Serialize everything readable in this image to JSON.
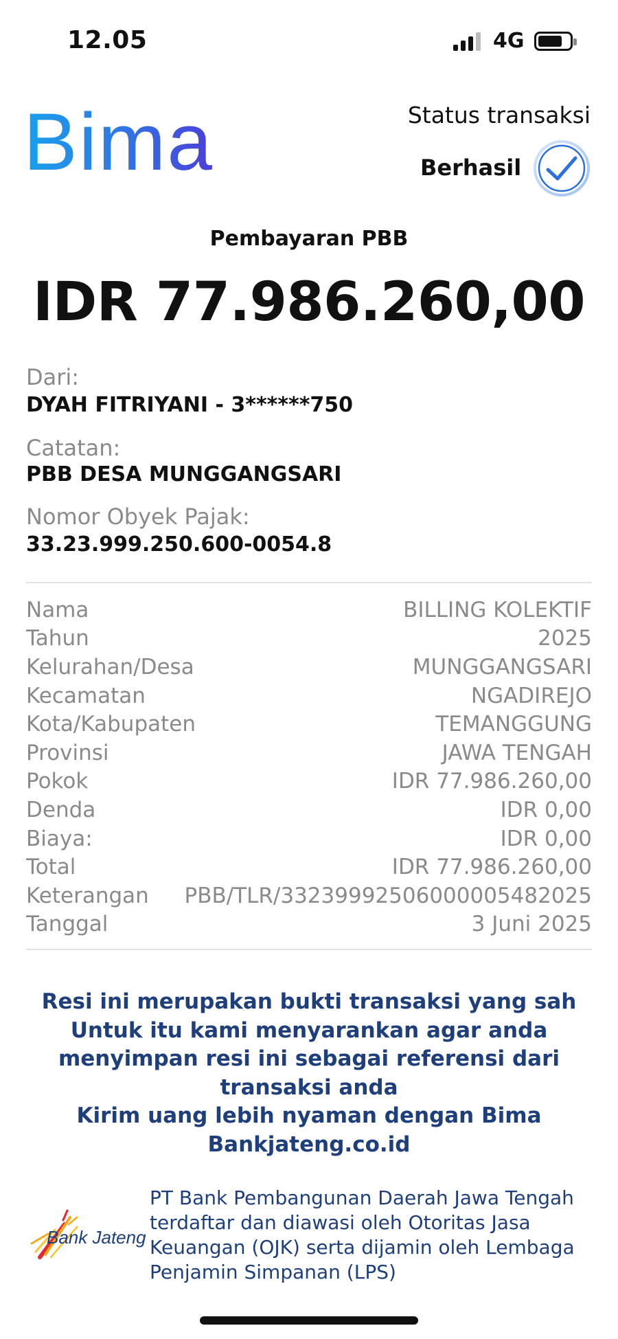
{
  "status_bar": {
    "time": "12.05",
    "network": "4G"
  },
  "header": {
    "logo_text": "Bima",
    "status_label": "Status transaksi",
    "status_value": "Berhasil",
    "status_icon": "checkmark-circle-icon"
  },
  "transaction": {
    "title": "Pembayaran PBB",
    "amount": "IDR 77.986.260,00"
  },
  "fields": {
    "from_label": "Dari:",
    "from_value": "DYAH FITRIYANI - 3******750",
    "note_label": "Catatan:",
    "note_value": "PBB DESA MUNGGANGSARI",
    "tax_object_label": "Nomor Obyek Pajak:",
    "tax_object_value": "33.23.999.250.600-0054.8"
  },
  "details": [
    {
      "label": "Nama",
      "value": "BILLING KOLEKTIF"
    },
    {
      "label": "Tahun",
      "value": "2025"
    },
    {
      "label": "Kelurahan/Desa",
      "value": "MUNGGANGSARI"
    },
    {
      "label": "Kecamatan",
      "value": "NGADIREJO"
    },
    {
      "label": "Kota/Kabupaten",
      "value": "TEMANGGUNG"
    },
    {
      "label": "Provinsi",
      "value": "JAWA TENGAH"
    },
    {
      "label": "Pokok",
      "value": "IDR 77.986.260,00"
    },
    {
      "label": "Denda",
      "value": "IDR 0,00"
    },
    {
      "label": "Biaya:",
      "value": "IDR 0,00"
    },
    {
      "label": "Total",
      "value": "IDR 77.986.260,00"
    },
    {
      "label": "Keterangan",
      "value": "PBB/TLR/33239992506000005482025"
    },
    {
      "label": "Tanggal",
      "value": "3 Juni 2025"
    }
  ],
  "footer_note": {
    "line1": "Resi ini merupakan bukti transaksi yang sah",
    "line2": "Untuk itu kami menyarankan agar anda",
    "line3": "menyimpan resi ini sebagai referensi dari",
    "line4": "transaksi anda",
    "line5": "Kirim uang lebih nyaman dengan Bima",
    "line6": "Bankjateng.co.id"
  },
  "bank": {
    "logo_text": "Bank Jateng",
    "legal_line1": "PT Bank Pembangunan Daerah Jawa Tengah",
    "legal_line2": "terdaftar dan diawasi oleh Otoritas Jasa",
    "legal_line3": "Keuangan (OJK) serta dijamin oleh Lembaga",
    "legal_line4": "Penjamin Simpanan (LPS)"
  },
  "colors": {
    "accent": "#1f3f7c",
    "logo_start": "#1aa0ea",
    "logo_end": "#4a3ed8",
    "check": "#2b6fe0"
  }
}
